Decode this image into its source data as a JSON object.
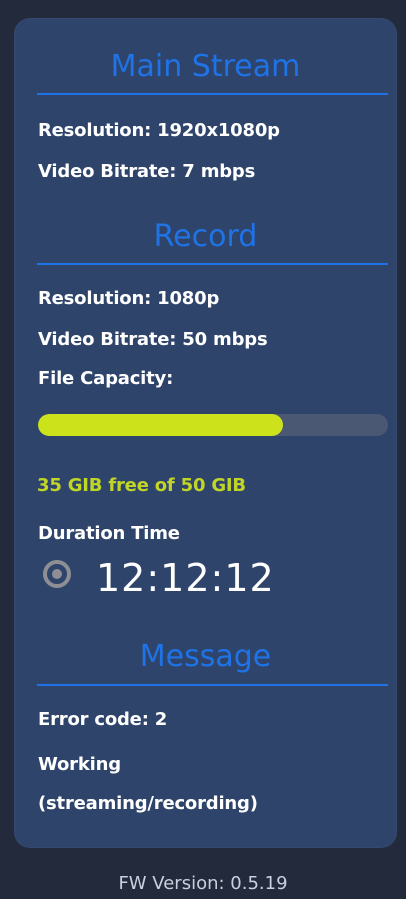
{
  "panel": {
    "main_stream": {
      "title": "Main Stream",
      "resolution": "Resolution: 1920x1080p",
      "bitrate": "Video Bitrate: 7 mbps"
    },
    "record": {
      "title": "Record",
      "resolution": "Resolution: 1080p",
      "bitrate": "Video Bitrate: 50 mbps",
      "file_capacity_label": "File Capacity:",
      "capacity_used_fraction": 0.7,
      "capacity_text": "35 GIB free of 50 GIB",
      "duration_label": "Duration Time",
      "duration_value": "12:12:12"
    },
    "message": {
      "title": "Message",
      "error_code": "Error code: 2",
      "status_line_1": "Working",
      "status_line_2": "(streaming/recording)"
    }
  },
  "footer": {
    "fw_version": "FW Version: 0.5.19"
  },
  "colors": {
    "background": "#232a3b",
    "card": "#2e446b",
    "accent": "#1f73e6",
    "capacity_fill": "#cce21b",
    "capacity_track": "#4a5874",
    "capacity_text": "#c1d527",
    "indicator": "#8d8f95"
  },
  "icons": {
    "record_indicator": "record-indicator-icon"
  }
}
